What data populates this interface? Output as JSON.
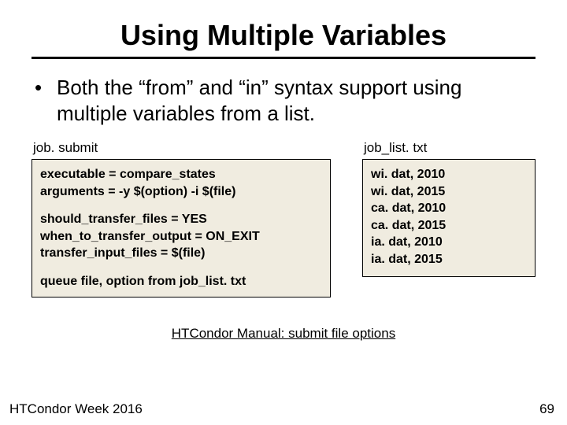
{
  "title": "Using Multiple Variables",
  "bullet": "Both the “from” and “in” syntax support using multiple variables from a list.",
  "left": {
    "label": "job. submit",
    "l1": "executable = compare_states",
    "l2": "arguments = -y $(option) -i $(file)",
    "l3": "should_transfer_files = YES",
    "l4": "when_to_transfer_output = ON_EXIT",
    "l5": "transfer_input_files = $(file)",
    "l6": "queue file, option from job_list. txt"
  },
  "right": {
    "label": "job_list. txt",
    "l1": "wi. dat, 2010",
    "l2": "wi. dat, 2015",
    "l3": "ca. dat, 2010",
    "l4": "ca. dat, 2015",
    "l5": "ia. dat, 2010",
    "l6": "ia. dat, 2015"
  },
  "link_text": "HTCondor Manual: submit file options",
  "footer_left": "HTCondor Week 2016",
  "footer_right": "69"
}
